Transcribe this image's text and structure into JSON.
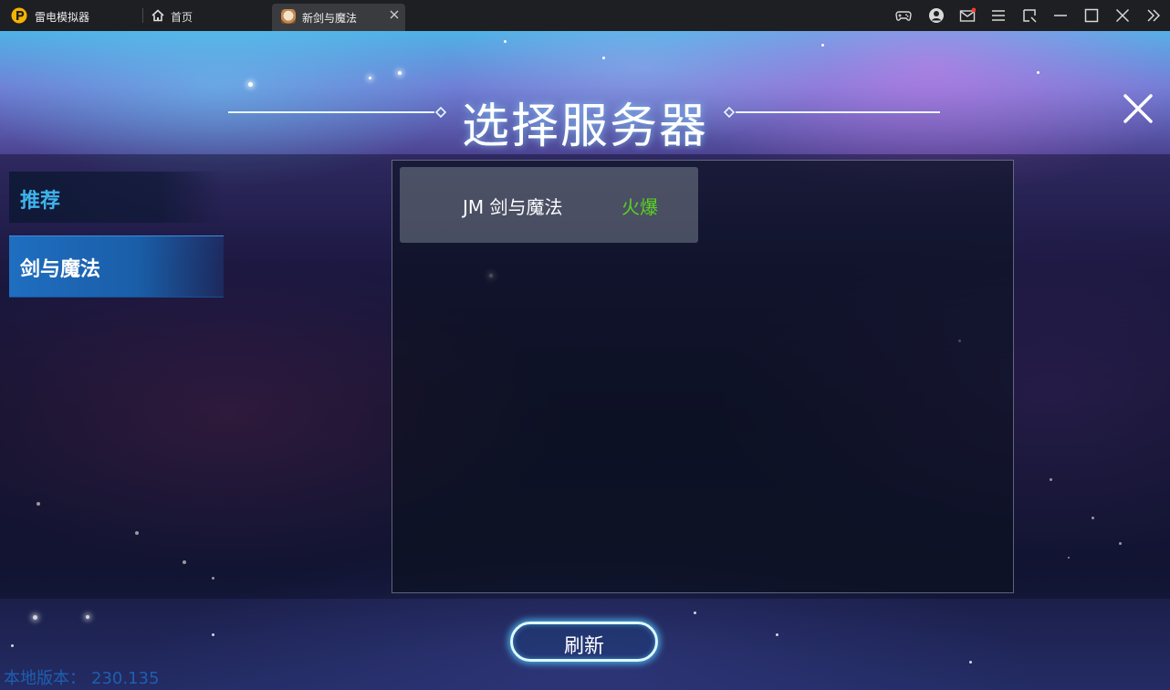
{
  "window": {
    "app_title": "雷电模拟器",
    "home_tab": "首页",
    "active_tab": "新剑与魔法",
    "accent_color": "#f5b400",
    "icons": [
      "gamepad-icon",
      "user-icon",
      "mail-icon",
      "menu-icon",
      "resize-icon",
      "minimize-icon",
      "maximize-icon",
      "close-icon",
      "expand-icon"
    ]
  },
  "game": {
    "header_title": "选择服务器",
    "tabs": [
      {
        "label": "推荐",
        "selected": false
      },
      {
        "label": "剑与魔法",
        "selected": true
      }
    ],
    "servers": [
      {
        "name": "JM  剑与魔法",
        "status": "火爆",
        "status_color": "#59d41f"
      }
    ],
    "refresh_label": "刷新",
    "version_label": "本地版本：",
    "version_value": "230.135"
  }
}
